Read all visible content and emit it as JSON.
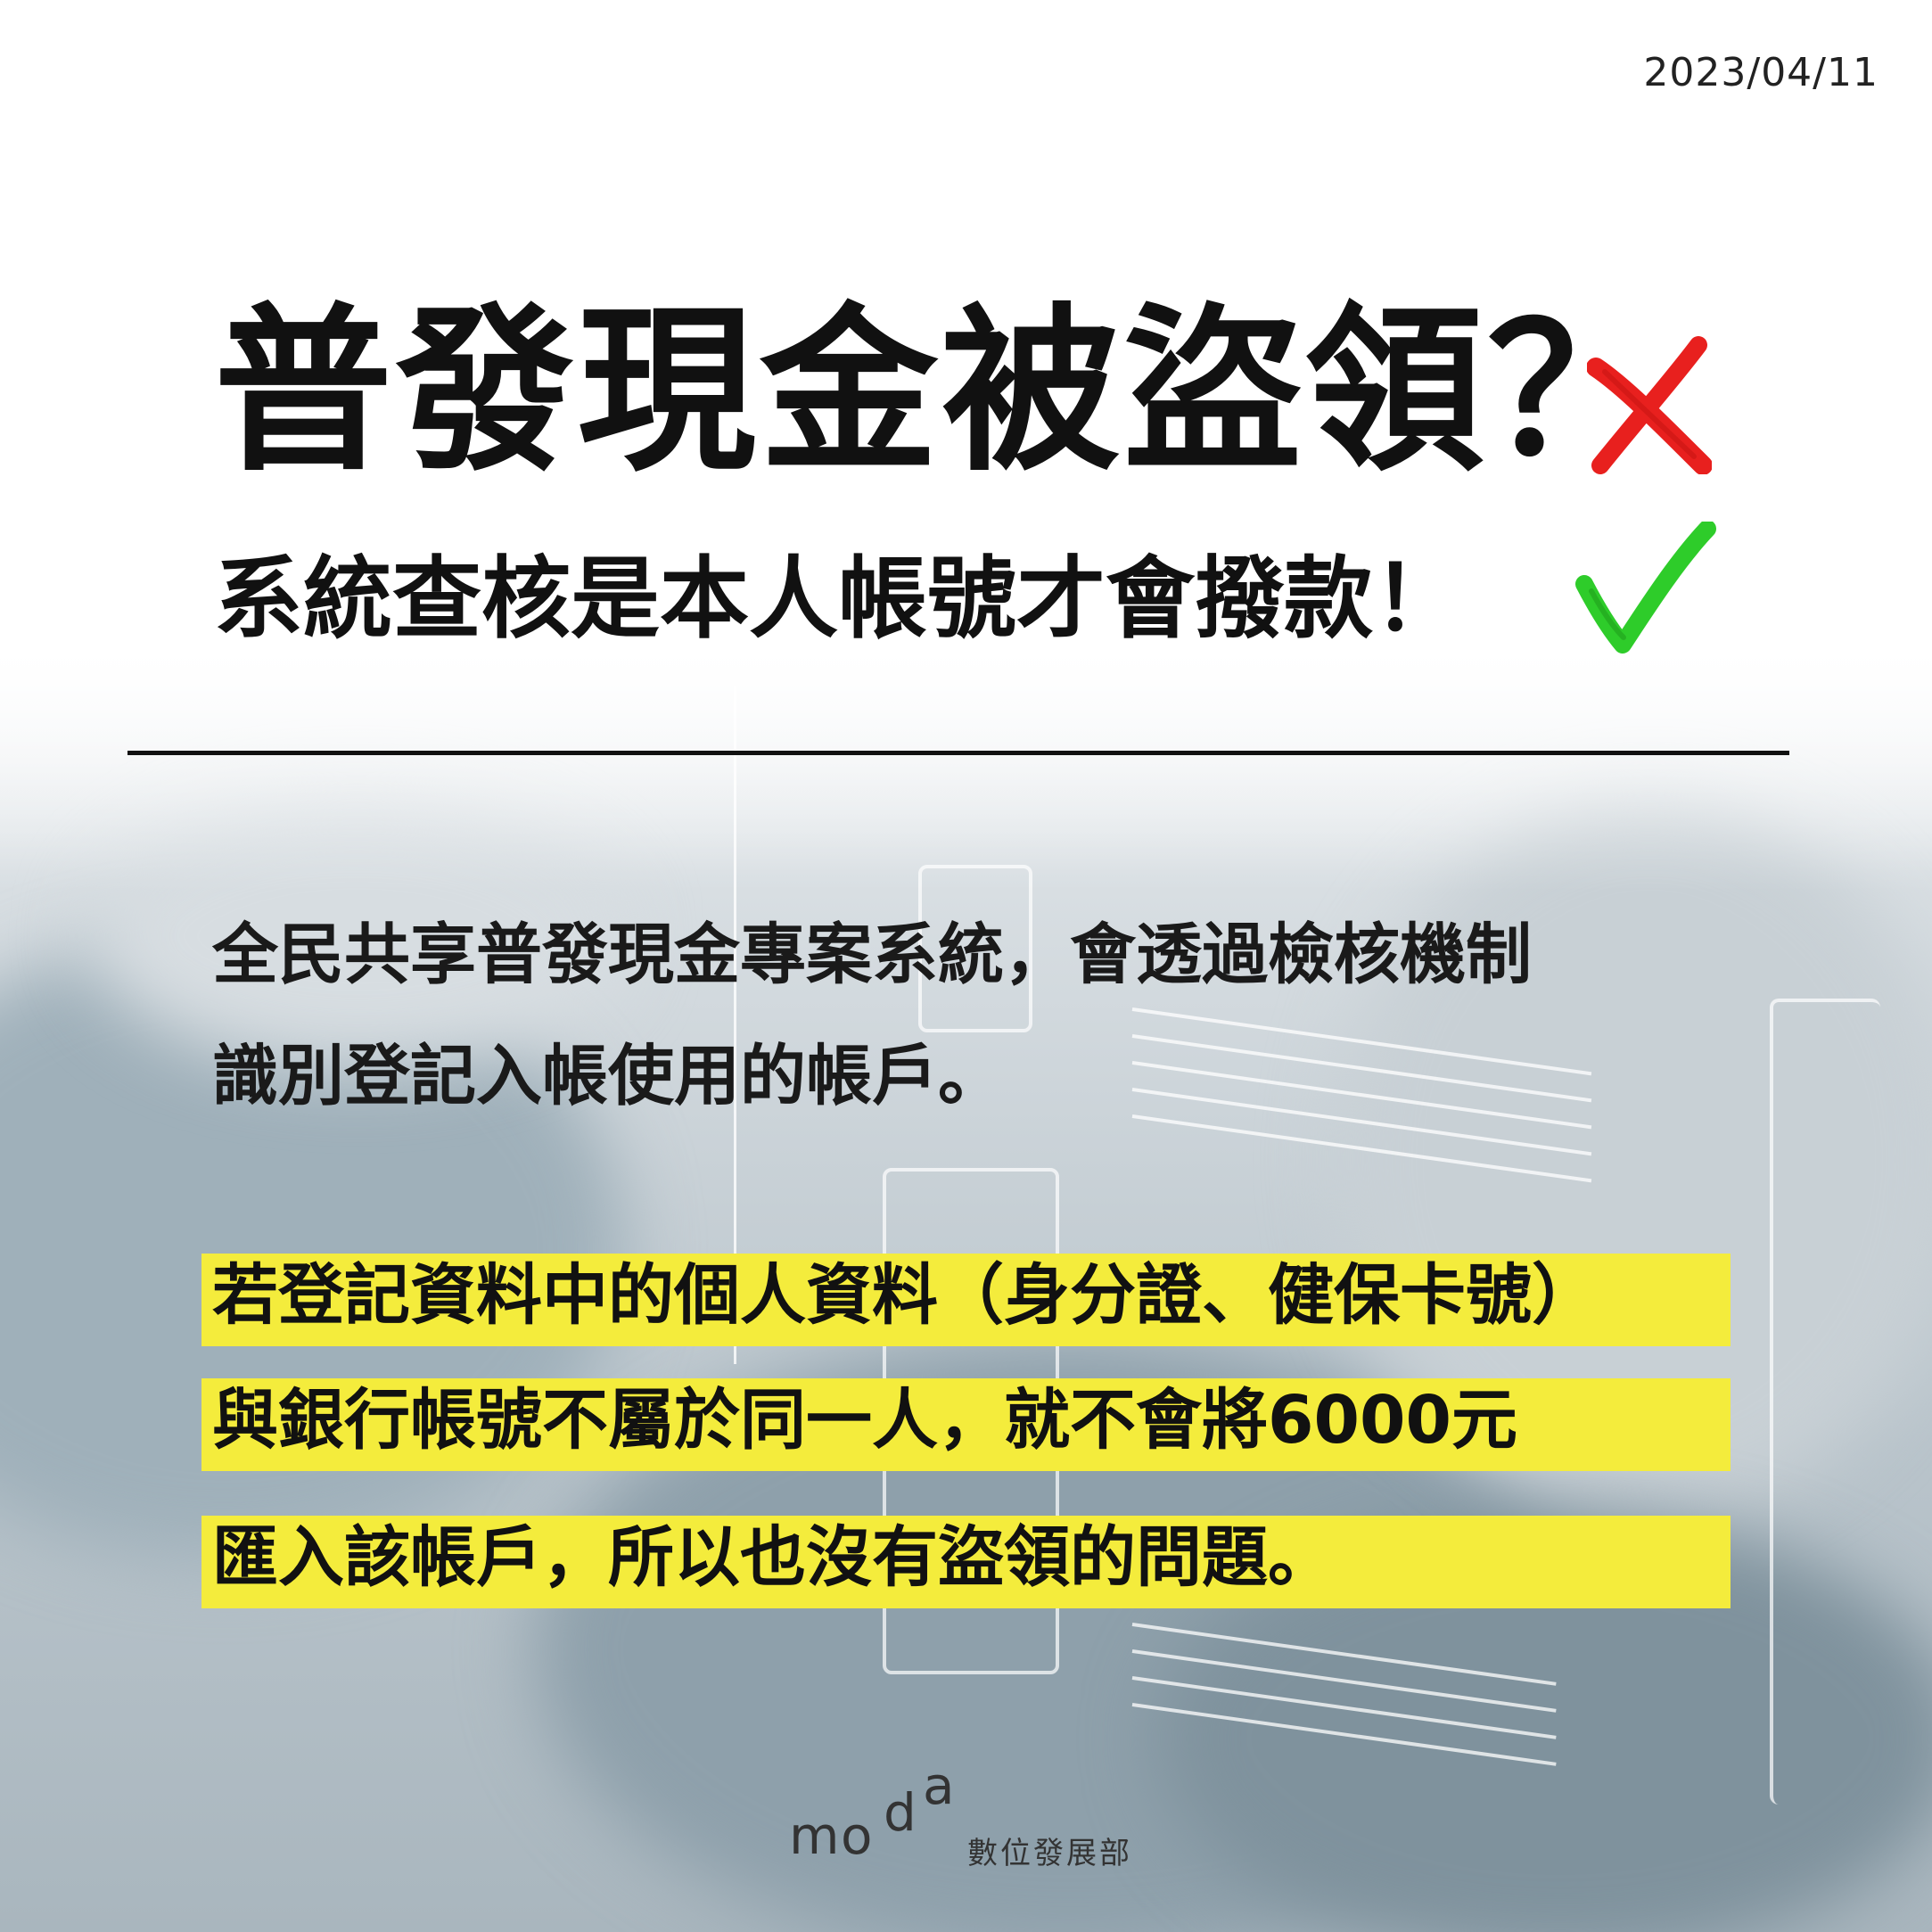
{
  "date": "2023/04/11",
  "title": "普發現金被盜領？",
  "subtitle": "系統查核是本人帳號才會撥款！",
  "paragraph1": [
    "全民共享普發現金專案系統，會透過檢核機制",
    "識別登記入帳使用的帳戶。"
  ],
  "paragraph2": [
    "若登記資料中的個人資料（身分證、健保卡號）",
    "與銀行帳號不屬於同一人，就不會將6000元",
    "匯入該帳戶，所以也沒有盜領的問題。"
  ],
  "logo": {
    "letters": [
      "m",
      "o",
      "d",
      "a"
    ],
    "org_name": "數位發展部"
  },
  "colors": {
    "highlight": "#f4ec3c",
    "cross": "#e8201e",
    "check": "#2ecc2a"
  },
  "icons": {
    "cross": "red-cross-mark-icon",
    "check": "green-check-mark-icon"
  }
}
